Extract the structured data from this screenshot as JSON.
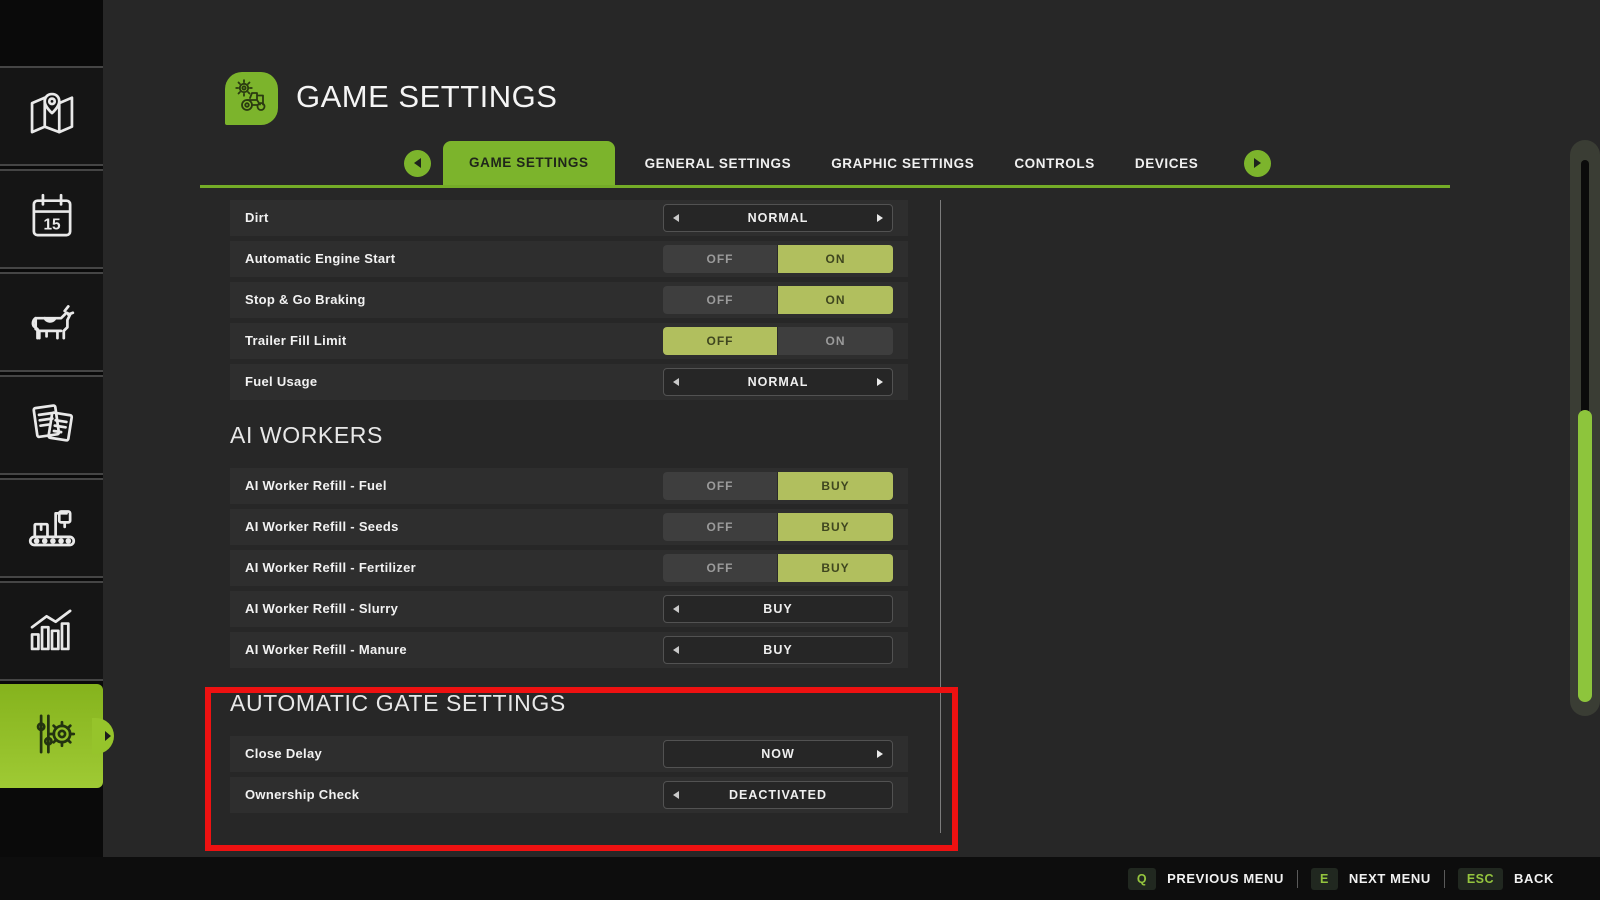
{
  "header": {
    "title": "GAME SETTINGS",
    "icon": "tractor-gear-icon"
  },
  "tabs": {
    "items": [
      {
        "label": "GAME SETTINGS",
        "active": true
      },
      {
        "label": "GENERAL SETTINGS",
        "active": false
      },
      {
        "label": "GRAPHIC SETTINGS",
        "active": false
      },
      {
        "label": "CONTROLS",
        "active": false
      },
      {
        "label": "DEVICES",
        "active": false
      }
    ]
  },
  "sidebar": {
    "items": [
      {
        "icon": "map-icon",
        "active": false
      },
      {
        "icon": "calendar-icon",
        "active": false
      },
      {
        "icon": "animals-icon",
        "active": false
      },
      {
        "icon": "finances-icon",
        "active": false
      },
      {
        "icon": "production-icon",
        "active": false
      },
      {
        "icon": "statistics-icon",
        "active": false
      },
      {
        "icon": "settings-icon",
        "active": true
      }
    ]
  },
  "settings_sections": [
    {
      "title": "",
      "rows": [
        {
          "label": "Dirt",
          "control": {
            "type": "selector",
            "value": "NORMAL",
            "arrows": "both"
          }
        },
        {
          "label": "Automatic Engine Start",
          "control": {
            "type": "toggle",
            "options": [
              "OFF",
              "ON"
            ],
            "active": "ON"
          }
        },
        {
          "label": "Stop & Go Braking",
          "control": {
            "type": "toggle",
            "options": [
              "OFF",
              "ON"
            ],
            "active": "ON"
          }
        },
        {
          "label": "Trailer Fill Limit",
          "control": {
            "type": "toggle",
            "options": [
              "OFF",
              "ON"
            ],
            "active": "OFF"
          }
        },
        {
          "label": "Fuel Usage",
          "control": {
            "type": "selector",
            "value": "NORMAL",
            "arrows": "both"
          }
        }
      ]
    },
    {
      "title": "AI WORKERS",
      "rows": [
        {
          "label": "AI Worker Refill - Fuel",
          "control": {
            "type": "toggle",
            "options": [
              "OFF",
              "BUY"
            ],
            "active": "BUY"
          }
        },
        {
          "label": "AI Worker Refill - Seeds",
          "control": {
            "type": "toggle",
            "options": [
              "OFF",
              "BUY"
            ],
            "active": "BUY"
          }
        },
        {
          "label": "AI Worker Refill - Fertilizer",
          "control": {
            "type": "toggle",
            "options": [
              "OFF",
              "BUY"
            ],
            "active": "BUY"
          }
        },
        {
          "label": "AI Worker Refill - Slurry",
          "control": {
            "type": "selector",
            "value": "BUY",
            "arrows": "left"
          }
        },
        {
          "label": "AI Worker Refill - Manure",
          "control": {
            "type": "selector",
            "value": "BUY",
            "arrows": "left"
          }
        }
      ]
    },
    {
      "title": "AUTOMATIC GATE SETTINGS",
      "highlighted": true,
      "rows": [
        {
          "label": "Close Delay",
          "control": {
            "type": "selector",
            "value": "NOW",
            "arrows": "right"
          }
        },
        {
          "label": "Ownership Check",
          "control": {
            "type": "selector",
            "value": "DEACTIVATED",
            "arrows": "left"
          }
        }
      ]
    }
  ],
  "footer": {
    "hints": [
      {
        "key": "Q",
        "label": "PREVIOUS MENU"
      },
      {
        "key": "E",
        "label": "NEXT MENU"
      },
      {
        "key": "ESC",
        "label": "BACK"
      }
    ]
  },
  "colors": {
    "accent_green": "#7cb42c",
    "toggle_active_green": "#b1bf5e",
    "scrollbar_green": "#8dc53c",
    "key_green": "#94c53e",
    "annotation_red": "#ee1111"
  }
}
